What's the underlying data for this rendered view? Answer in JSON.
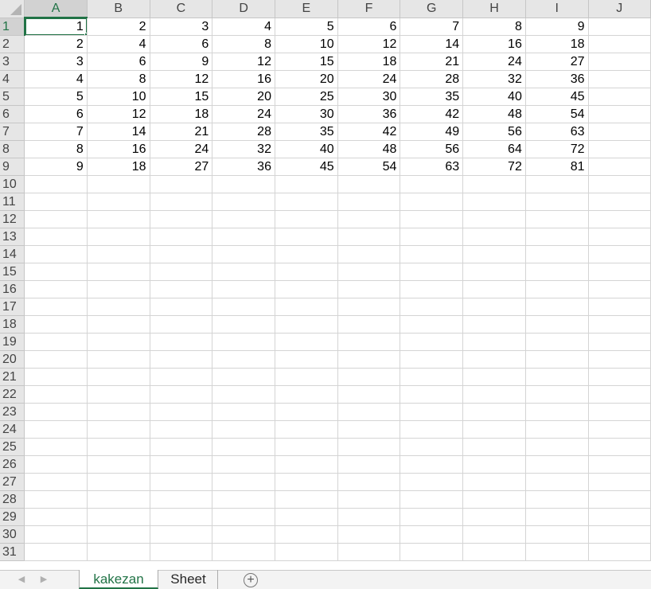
{
  "columns": [
    "A",
    "B",
    "C",
    "D",
    "E",
    "F",
    "G",
    "H",
    "I",
    "J"
  ],
  "selected_column": "A",
  "selected_row": 1,
  "rows": [
    {
      "num": "1",
      "cells": [
        "1",
        "2",
        "3",
        "4",
        "5",
        "6",
        "7",
        "8",
        "9",
        ""
      ]
    },
    {
      "num": "2",
      "cells": [
        "2",
        "4",
        "6",
        "8",
        "10",
        "12",
        "14",
        "16",
        "18",
        ""
      ]
    },
    {
      "num": "3",
      "cells": [
        "3",
        "6",
        "9",
        "12",
        "15",
        "18",
        "21",
        "24",
        "27",
        ""
      ]
    },
    {
      "num": "4",
      "cells": [
        "4",
        "8",
        "12",
        "16",
        "20",
        "24",
        "28",
        "32",
        "36",
        ""
      ]
    },
    {
      "num": "5",
      "cells": [
        "5",
        "10",
        "15",
        "20",
        "25",
        "30",
        "35",
        "40",
        "45",
        ""
      ]
    },
    {
      "num": "6",
      "cells": [
        "6",
        "12",
        "18",
        "24",
        "30",
        "36",
        "42",
        "48",
        "54",
        ""
      ]
    },
    {
      "num": "7",
      "cells": [
        "7",
        "14",
        "21",
        "28",
        "35",
        "42",
        "49",
        "56",
        "63",
        ""
      ]
    },
    {
      "num": "8",
      "cells": [
        "8",
        "16",
        "24",
        "32",
        "40",
        "48",
        "56",
        "64",
        "72",
        ""
      ]
    },
    {
      "num": "9",
      "cells": [
        "9",
        "18",
        "27",
        "36",
        "45",
        "54",
        "63",
        "72",
        "81",
        ""
      ]
    },
    {
      "num": "10",
      "cells": [
        "",
        "",
        "",
        "",
        "",
        "",
        "",
        "",
        "",
        ""
      ]
    },
    {
      "num": "11",
      "cells": [
        "",
        "",
        "",
        "",
        "",
        "",
        "",
        "",
        "",
        ""
      ]
    },
    {
      "num": "12",
      "cells": [
        "",
        "",
        "",
        "",
        "",
        "",
        "",
        "",
        "",
        ""
      ]
    },
    {
      "num": "13",
      "cells": [
        "",
        "",
        "",
        "",
        "",
        "",
        "",
        "",
        "",
        ""
      ]
    },
    {
      "num": "14",
      "cells": [
        "",
        "",
        "",
        "",
        "",
        "",
        "",
        "",
        "",
        ""
      ]
    },
    {
      "num": "15",
      "cells": [
        "",
        "",
        "",
        "",
        "",
        "",
        "",
        "",
        "",
        ""
      ]
    },
    {
      "num": "16",
      "cells": [
        "",
        "",
        "",
        "",
        "",
        "",
        "",
        "",
        "",
        ""
      ]
    },
    {
      "num": "17",
      "cells": [
        "",
        "",
        "",
        "",
        "",
        "",
        "",
        "",
        "",
        ""
      ]
    },
    {
      "num": "18",
      "cells": [
        "",
        "",
        "",
        "",
        "",
        "",
        "",
        "",
        "",
        ""
      ]
    },
    {
      "num": "19",
      "cells": [
        "",
        "",
        "",
        "",
        "",
        "",
        "",
        "",
        "",
        ""
      ]
    },
    {
      "num": "20",
      "cells": [
        "",
        "",
        "",
        "",
        "",
        "",
        "",
        "",
        "",
        ""
      ]
    },
    {
      "num": "21",
      "cells": [
        "",
        "",
        "",
        "",
        "",
        "",
        "",
        "",
        "",
        ""
      ]
    },
    {
      "num": "22",
      "cells": [
        "",
        "",
        "",
        "",
        "",
        "",
        "",
        "",
        "",
        ""
      ]
    },
    {
      "num": "23",
      "cells": [
        "",
        "",
        "",
        "",
        "",
        "",
        "",
        "",
        "",
        ""
      ]
    },
    {
      "num": "24",
      "cells": [
        "",
        "",
        "",
        "",
        "",
        "",
        "",
        "",
        "",
        ""
      ]
    },
    {
      "num": "25",
      "cells": [
        "",
        "",
        "",
        "",
        "",
        "",
        "",
        "",
        "",
        ""
      ]
    },
    {
      "num": "26",
      "cells": [
        "",
        "",
        "",
        "",
        "",
        "",
        "",
        "",
        "",
        ""
      ]
    },
    {
      "num": "27",
      "cells": [
        "",
        "",
        "",
        "",
        "",
        "",
        "",
        "",
        "",
        ""
      ]
    },
    {
      "num": "28",
      "cells": [
        "",
        "",
        "",
        "",
        "",
        "",
        "",
        "",
        "",
        ""
      ]
    },
    {
      "num": "29",
      "cells": [
        "",
        "",
        "",
        "",
        "",
        "",
        "",
        "",
        "",
        ""
      ]
    },
    {
      "num": "30",
      "cells": [
        "",
        "",
        "",
        "",
        "",
        "",
        "",
        "",
        "",
        ""
      ]
    },
    {
      "num": "31",
      "cells": [
        "",
        "",
        "",
        "",
        "",
        "",
        "",
        "",
        "",
        ""
      ]
    }
  ],
  "sheet_bar": {
    "nav_prev_icon": "chevron-left-icon",
    "nav_next_icon": "chevron-right-icon",
    "tabs": [
      {
        "label": "kakezan",
        "active": true
      },
      {
        "label": "Sheet",
        "active": false
      }
    ],
    "add_sheet_icon": "plus-circle-icon",
    "add_sheet_glyph": "+"
  },
  "colors": {
    "accent": "#217346",
    "header_bg": "#e6e6e6",
    "gridline": "#d4d4d4"
  }
}
